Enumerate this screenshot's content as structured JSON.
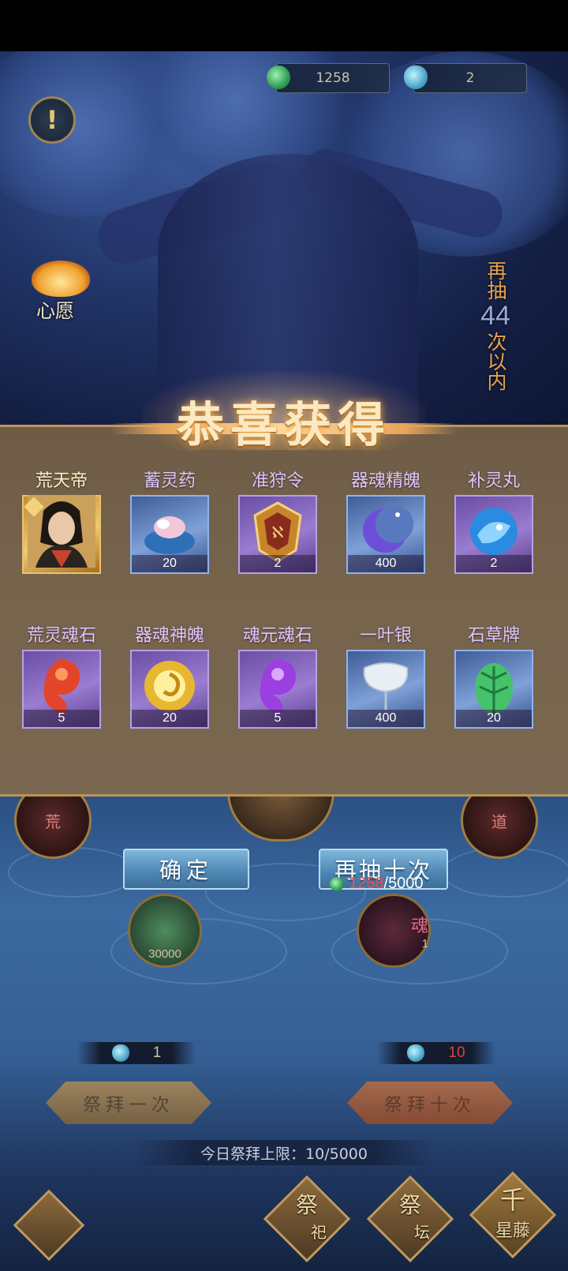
{
  "currency": {
    "jade": "1258",
    "gourd": "2"
  },
  "top": {
    "wish_label": "心愿"
  },
  "side_counter": {
    "prefix": "再抽",
    "count": "44",
    "suffix": "次以内"
  },
  "panel": {
    "title": "恭喜获得",
    "items": [
      {
        "name": "荒天帝",
        "count": ""
      },
      {
        "name": "蓄灵药",
        "count": "20"
      },
      {
        "name": "准狩令",
        "count": "2"
      },
      {
        "name": "器魂精魄",
        "count": "400"
      },
      {
        "name": "补灵丸",
        "count": "2"
      },
      {
        "name": "荒灵魂石",
        "count": "5"
      },
      {
        "name": "器魂神魄",
        "count": "20"
      },
      {
        "name": "魂元魂石",
        "count": "5"
      },
      {
        "name": "一叶银",
        "count": "400"
      },
      {
        "name": "石草牌",
        "count": "20"
      }
    ],
    "confirm_label": "确定",
    "draw_ten_label": "再抽十次",
    "cost_have": "1258",
    "cost_sep": "/",
    "cost_need": "5000"
  },
  "scene": {
    "medallion_left": "荒",
    "medallion_right": "道",
    "token_left_value": "30000",
    "token_right_glyph": "魂",
    "token_right_value": "1",
    "ink_left": "1",
    "ink_right": "10",
    "worship_once": "祭拜一次",
    "worship_ten": "祭拜十次",
    "daily_limit": "今日祭拜上限：10/5000",
    "nav": [
      {
        "line1": "祭",
        "line2": "祀"
      },
      {
        "line1": "祭",
        "line2": "坛"
      },
      {
        "line1": "千",
        "line2": "星藤"
      }
    ]
  }
}
